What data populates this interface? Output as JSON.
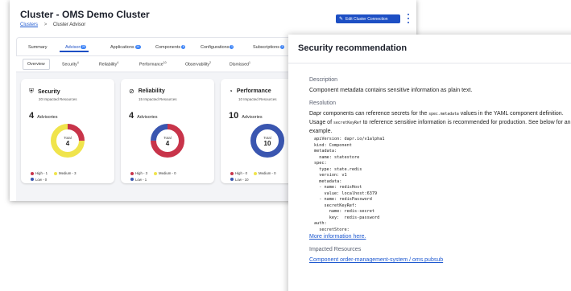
{
  "header": {
    "title": "Cluster - OMS Demo Cluster",
    "breadcrumb_root": "Clusters",
    "breadcrumb_sep": ">",
    "breadcrumb_current": "Cluster Advisor",
    "edit_button": "Edit Cluster Connection"
  },
  "tabs": [
    {
      "label": "Summary",
      "badge": ""
    },
    {
      "label": "Advisor",
      "badge": "20"
    },
    {
      "label": "Applications",
      "badge": "14"
    },
    {
      "label": "Components",
      "badge": "6"
    },
    {
      "label": "Configurations",
      "badge": "1"
    },
    {
      "label": "Subscriptions",
      "badge": "3"
    }
  ],
  "subtabs": [
    {
      "label": "Overview",
      "count": ""
    },
    {
      "label": "Security",
      "count": "4"
    },
    {
      "label": "Reliability",
      "count": "4"
    },
    {
      "label": "Performance",
      "count": "10"
    },
    {
      "label": "Observability",
      "count": "2"
    },
    {
      "label": "Dismissed",
      "count": "1"
    }
  ],
  "cards": [
    {
      "title": "Security",
      "icon": "shield-icon",
      "subtitle": "20 Impacted Resources",
      "count": "4",
      "count_label": "Advisories",
      "total_label": "Total",
      "total": "4",
      "chart_data": {
        "type": "pie",
        "categories": [
          "High",
          "Medium",
          "Low"
        ],
        "values": [
          1,
          3,
          0
        ]
      },
      "legend": [
        "High - 1",
        "Medium - 3",
        "Low - 0"
      ]
    },
    {
      "title": "Reliability",
      "icon": "check-circle-icon",
      "subtitle": "15 Impacted Resources",
      "count": "4",
      "count_label": "Advisories",
      "total_label": "Total",
      "total": "4",
      "chart_data": {
        "type": "pie",
        "categories": [
          "High",
          "Medium",
          "Low"
        ],
        "values": [
          3,
          0,
          1
        ]
      },
      "legend": [
        "High - 3",
        "Medium - 0",
        "Low - 1"
      ]
    },
    {
      "title": "Performance",
      "icon": "gauge-icon",
      "subtitle": "10 Impacted Resources",
      "count": "10",
      "count_label": "Advisories",
      "total_label": "Total",
      "total": "10",
      "chart_data": {
        "type": "pie",
        "categories": [
          "High",
          "Medium",
          "Low"
        ],
        "values": [
          0,
          0,
          10
        ]
      },
      "legend": [
        "High - 0",
        "Medium - 0",
        "Low - 10"
      ]
    }
  ],
  "colors": {
    "high": "#c8344a",
    "medium": "#f0e44c",
    "low": "#3a56b0",
    "accent": "#1d4fc4"
  },
  "panel": {
    "title": "Security recommendation",
    "description_label": "Description",
    "description": "Component metadata contains sensitive information as plain text.",
    "resolution_label": "Resolution",
    "resolution_1a": "Dapr components can reference secrets for the",
    "resolution_1_code": "spec.metadata",
    "resolution_1b": "values in the YAML component definition.",
    "resolution_2a": "Usage of",
    "resolution_2_code": "secretKeyRef",
    "resolution_2b": "to reference sensitive information is recommended for production. See below for an example.",
    "yaml": "apiVersion: dapr.io/v1alpha1\nkind: Component\nmetadata:\n  name: statestore\nspec:\n  type: state.redis\n  version: v1\n  metadata:\n  - name: redisHost\n    value: localhost:6379\n  - name: redisPassword\n    secretKeyRef:\n      name: redis-secret\n      key:  redis-password\nauth:\n  secretStore: ",
    "more_info": "More information here.",
    "impacted_label": "Impacted Resources",
    "impacted_link": "Component order-management-system / oms.pubsub"
  }
}
